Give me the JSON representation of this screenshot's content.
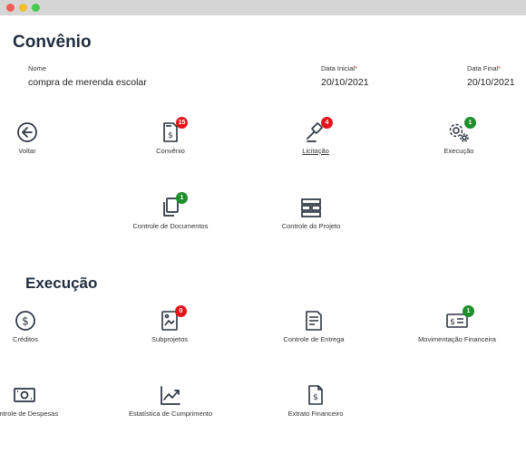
{
  "window": {
    "buttons": [
      "close",
      "minimize",
      "maximize"
    ]
  },
  "header": {
    "title": "Convênio"
  },
  "fields": {
    "nome": {
      "label": "Nome",
      "value": "compra de merenda escolar"
    },
    "data_inicial": {
      "label": "Data Inicial",
      "required": "*",
      "value": "20/10/2021"
    },
    "data_final": {
      "label": "Data Final",
      "required": "*",
      "value": "20/10/2021"
    }
  },
  "nav": {
    "voltar": {
      "label": "Voltar",
      "icon": "arrow-left-circle-icon"
    },
    "convenio": {
      "label": "Convênio",
      "icon": "document-dollar-icon",
      "badge": "15",
      "badge_color": "#e4161c"
    },
    "licitacao": {
      "label": "Licitação",
      "icon": "gavel-icon",
      "badge": "4",
      "badge_color": "#e4161c"
    },
    "execucao": {
      "label": "Execução",
      "icon": "gears-icon",
      "badge": "1",
      "badge_color": "#1d8f2a"
    },
    "controle_documentos": {
      "label": "Controle de Documentos",
      "icon": "documents-copy-icon",
      "badge": "1",
      "badge_color": "#1d8f2a"
    },
    "controle_projeto": {
      "label": "Controle do Projeto",
      "icon": "layout-grid-icon"
    }
  },
  "execucao_section": {
    "title": "Execução",
    "items": {
      "creditos": {
        "label": "Créditos",
        "icon": "coin-dollar-icon"
      },
      "subprojetos": {
        "label": "Subprojetos",
        "icon": "image-document-icon",
        "badge": "0",
        "badge_color": "#e4161c"
      },
      "controle_entrega": {
        "label": "Controle de Entrega",
        "icon": "delivery-doc-icon"
      },
      "movimentacao_financeira": {
        "label": "Movimentação Financeira",
        "icon": "check-dollar-icon",
        "badge": "1",
        "badge_color": "#1d8f2a"
      },
      "controle_despesas": {
        "label": "Controle de Despesas",
        "icon": "banknote-icon"
      },
      "estatistica_cumprimento": {
        "label": "Estatística de Cumprimento",
        "icon": "trend-chart-icon"
      },
      "extrato_financeiro": {
        "label": "Extrato Financeiro",
        "icon": "receipt-dollar-icon"
      }
    }
  }
}
